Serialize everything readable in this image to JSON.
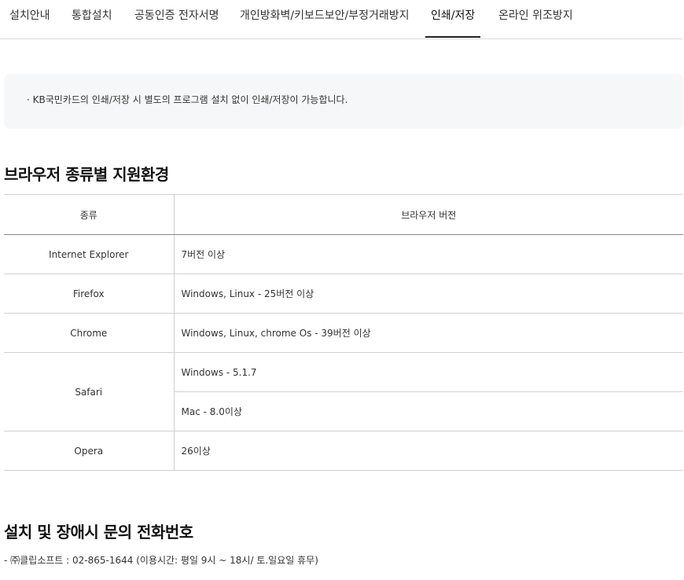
{
  "tabs": [
    {
      "label": "설치안내",
      "active": false
    },
    {
      "label": "통합설치",
      "active": false
    },
    {
      "label": "공동인증 전자서명",
      "active": false
    },
    {
      "label": "개인방화벽/키보드보안/부정거래방지",
      "active": false
    },
    {
      "label": "인쇄/저장",
      "active": true
    },
    {
      "label": "온라인 위조방지",
      "active": false
    }
  ],
  "notice": {
    "text": "· KB국민카드의 인쇄/저장 시 별도의 프로그램 설치 없이 인쇄/저장이 가능합니다."
  },
  "browser_section": {
    "title": "브라우저 종류별 지원환경",
    "headers": [
      "종류",
      "브라우저 버전"
    ],
    "rows": [
      {
        "name": "Internet Explorer",
        "versions": [
          "7버전 이상"
        ]
      },
      {
        "name": "Firefox",
        "versions": [
          "Windows, Linux - 25버전 이상"
        ]
      },
      {
        "name": "Chrome",
        "versions": [
          "Windows, Linux, chrome Os - 39버전 이상"
        ]
      },
      {
        "name": "Safari",
        "versions": [
          "Windows - 5.1.7",
          "Mac - 8.0이상"
        ]
      },
      {
        "name": "Opera",
        "versions": [
          "26이상"
        ]
      }
    ]
  },
  "contact": {
    "title": "설치 및 장애시 문의 전화번호",
    "line": "- ㈜클립소프트 : 02-865-1644 (이용시간: 평일 9시 ~ 18시/ 토.일요일 휴무)"
  }
}
